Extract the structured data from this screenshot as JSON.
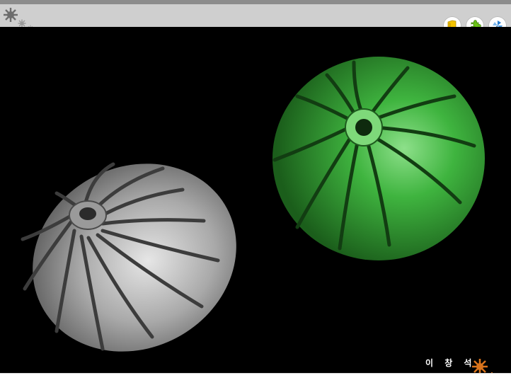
{
  "header": {
    "logo_icon": "gear-cluster-icon",
    "buttons": [
      {
        "name": "folder-button",
        "icon": "yellow-folder-icon",
        "color": "#f2c200"
      },
      {
        "name": "puzzle-button",
        "icon": "green-puzzle-icon",
        "color": "#6cc417"
      },
      {
        "name": "pinwheel-button",
        "icon": "blue-pinwheel-icon",
        "color": "#2a7fd0"
      }
    ]
  },
  "stage": {
    "background": "#000000",
    "left_image": {
      "icon": "gray-impeller-image",
      "color": "#b8b8b8"
    },
    "right_image": {
      "icon": "green-impeller-image",
      "color": "#2f9e2f"
    }
  },
  "footer": {
    "author": "이 창 석",
    "deco_icon": "orange-gear-cluster-icon",
    "deco_color": "#d9731c"
  }
}
